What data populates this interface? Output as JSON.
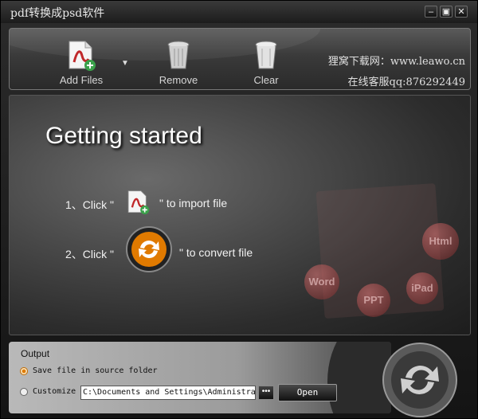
{
  "window": {
    "title": "pdf转换成psd软件"
  },
  "titlebar_buttons": {
    "minimize": "–",
    "restore": "▣",
    "close": "✕"
  },
  "toolbar": {
    "add_files": "Add Files",
    "dropdown": "▼",
    "remove": "Remove",
    "clear": "Clear",
    "site": "狸窝下载网：www.leawo.cn",
    "qq": "在线客服qq:876292449"
  },
  "main": {
    "heading": "Getting started",
    "step1_prefix": "1、Click \"",
    "step1_suffix": "\" to import file",
    "step2_prefix": "2、Click \"",
    "step2_suffix": "\" to convert file",
    "bg_labels": {
      "word": "Word",
      "ppt": "PPT",
      "ipad": "iPad",
      "html": "Html"
    }
  },
  "output": {
    "title": "Output",
    "option_source": "Save file in source folder",
    "option_custom": "Customize",
    "path": "C:\\Documents and Settings\\Administrator\\My Documents",
    "browse": "•••",
    "open": "Open",
    "selected": "source"
  },
  "colors": {
    "accent": "#e07a00",
    "pdf_red": "#c0282a",
    "add_green": "#3aa14a"
  }
}
